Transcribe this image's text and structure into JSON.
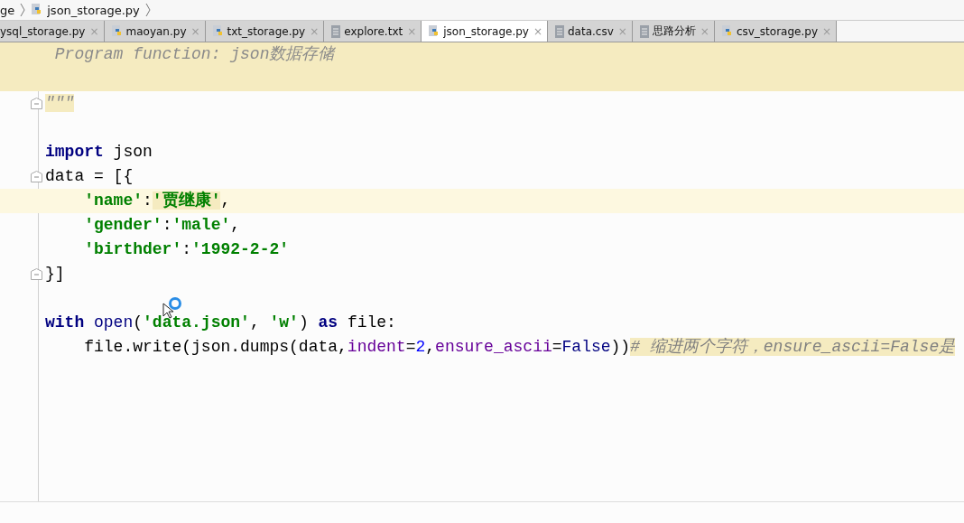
{
  "breadcrumb": [
    {
      "label": "ge",
      "kind": "plain"
    },
    {
      "label": "json_storage.py",
      "kind": "python"
    }
  ],
  "tabs": [
    {
      "label": "ysql_storage.py",
      "kind": "plain",
      "selected": false
    },
    {
      "label": "maoyan.py",
      "kind": "python",
      "selected": false
    },
    {
      "label": "txt_storage.py",
      "kind": "python",
      "selected": false
    },
    {
      "label": "explore.txt",
      "kind": "text",
      "selected": false
    },
    {
      "label": "json_storage.py",
      "kind": "python",
      "selected": true
    },
    {
      "label": "data.csv",
      "kind": "text",
      "selected": false
    },
    {
      "label": "思路分析",
      "kind": "text",
      "selected": false
    },
    {
      "label": "csv_storage.py",
      "kind": "python",
      "selected": false
    }
  ],
  "close_glyph": "×",
  "code_lines": [
    {
      "fold": false,
      "current": false,
      "band": true,
      "indented": false,
      "tokens": [
        {
          "kind": "docstring",
          "text": " Program function: json数据存储",
          "highlighted": false
        }
      ]
    },
    {
      "fold": false,
      "current": false,
      "band": true
    },
    {
      "fold": true,
      "current": false,
      "band": false,
      "indented": false,
      "tokens": [
        {
          "kind": "docstring",
          "text": "\"\"\"",
          "highlighted": true
        }
      ]
    },
    {
      "fold": false,
      "current": false,
      "band": false
    },
    {
      "fold": false,
      "current": false,
      "band": false,
      "indented": false,
      "tokens": [
        {
          "kind": "keyword",
          "text": "import",
          "highlighted": false
        },
        {
          "kind": "plain",
          "text": " json",
          "highlighted": false
        }
      ]
    },
    {
      "fold": true,
      "current": false,
      "band": false,
      "indented": false,
      "tokens": [
        {
          "kind": "plain",
          "text": "data = [{",
          "highlighted": false
        }
      ]
    },
    {
      "fold": false,
      "current": true,
      "band": false,
      "indented": true,
      "tokens": [
        {
          "kind": "string",
          "text": "'name'",
          "highlighted": false
        },
        {
          "kind": "plain",
          "text": ":",
          "highlighted": false
        },
        {
          "kind": "string",
          "text": "'贾继康'",
          "highlighted": true
        },
        {
          "kind": "plain",
          "text": ",",
          "highlighted": false
        }
      ]
    },
    {
      "fold": false,
      "current": false,
      "band": false,
      "indented": true,
      "tokens": [
        {
          "kind": "string",
          "text": "'gender'",
          "highlighted": false
        },
        {
          "kind": "plain",
          "text": ":",
          "highlighted": false
        },
        {
          "kind": "string",
          "text": "'male'",
          "highlighted": false
        },
        {
          "kind": "plain",
          "text": ",",
          "highlighted": false
        }
      ]
    },
    {
      "fold": false,
      "current": false,
      "band": false,
      "indented": true,
      "tokens": [
        {
          "kind": "string",
          "text": "'birthder'",
          "highlighted": false
        },
        {
          "kind": "plain",
          "text": ":",
          "highlighted": false
        },
        {
          "kind": "string",
          "text": "'1992-2-2'",
          "highlighted": false
        }
      ]
    },
    {
      "fold": true,
      "current": false,
      "band": false,
      "indented": false,
      "tokens": [
        {
          "kind": "plain",
          "text": "}]",
          "highlighted": false
        }
      ]
    },
    {
      "fold": false,
      "current": false,
      "band": false
    },
    {
      "fold": false,
      "current": false,
      "band": false,
      "indented": false,
      "tokens": [
        {
          "kind": "keyword",
          "text": "with",
          "highlighted": false
        },
        {
          "kind": "builtin",
          "text": " open",
          "highlighted": false
        },
        {
          "kind": "plain",
          "text": "(",
          "highlighted": false
        },
        {
          "kind": "string",
          "text": "'data.json'",
          "highlighted": false
        },
        {
          "kind": "plain",
          "text": ", ",
          "highlighted": false
        },
        {
          "kind": "string",
          "text": "'w'",
          "highlighted": false
        },
        {
          "kind": "plain",
          "text": ") ",
          "highlighted": false
        },
        {
          "kind": "keyword",
          "text": "as",
          "highlighted": false
        },
        {
          "kind": "plain",
          "text": " file:",
          "highlighted": false
        }
      ]
    },
    {
      "fold": false,
      "current": false,
      "band": false,
      "indented": true,
      "tokens": [
        {
          "kind": "plain",
          "text": "file.write(json.dumps(data,",
          "highlighted": false
        },
        {
          "kind": "param",
          "text": "indent",
          "highlighted": false
        },
        {
          "kind": "plain",
          "text": "=",
          "highlighted": false
        },
        {
          "kind": "number",
          "text": "2",
          "highlighted": false
        },
        {
          "kind": "plain",
          "text": ",",
          "highlighted": false
        },
        {
          "kind": "param",
          "text": "ensure_ascii",
          "highlighted": false
        },
        {
          "kind": "plain",
          "text": "=",
          "highlighted": false
        },
        {
          "kind": "builtin",
          "text": "False",
          "highlighted": false
        },
        {
          "kind": "plain",
          "text": "))",
          "highlighted": false
        },
        {
          "kind": "comment",
          "text": "# 缩进两个字符，ensure_ascii=False是",
          "highlighted": true
        }
      ]
    }
  ]
}
